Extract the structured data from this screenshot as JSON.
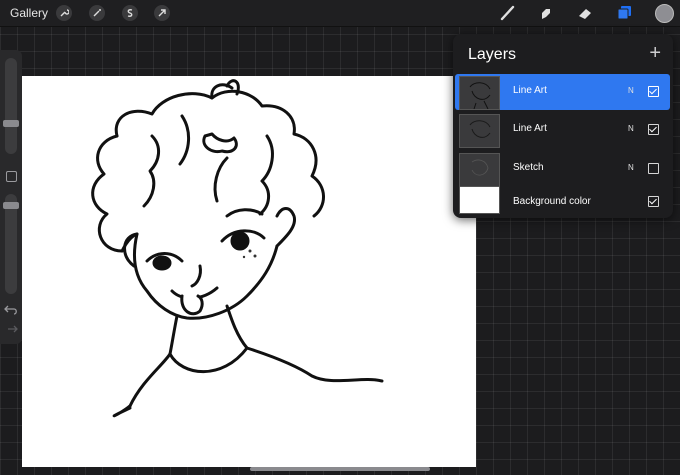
{
  "toolbar": {
    "gallery_label": "Gallery",
    "left_tools": [
      "wrench-icon",
      "magic-wand-icon",
      "selection-icon",
      "transform-arrow-icon"
    ],
    "right_tools": [
      "brush-icon",
      "smudge-icon",
      "eraser-icon",
      "layers-icon"
    ],
    "active_tool": "layers-icon",
    "current_color": "#8e8e93"
  },
  "sidebar": {
    "brush_size": 0.47,
    "opacity": 0.1,
    "buttons": [
      "undo-icon",
      "redo-icon",
      "modify-button"
    ]
  },
  "layers": {
    "title": "Layers",
    "add_icon": "+",
    "items": [
      {
        "name": "Line Art",
        "blend": "N",
        "visible": true,
        "active": true
      },
      {
        "name": "Line Art",
        "blend": "N",
        "visible": true,
        "active": false
      },
      {
        "name": "Sketch",
        "blend": "N",
        "visible": false,
        "active": false
      },
      {
        "name": "Background color",
        "blend": "",
        "visible": true,
        "active": false
      }
    ]
  },
  "colors": {
    "accent": "#2f78f0",
    "panel": "#1d1d1f",
    "canvas": "#ffffff"
  }
}
